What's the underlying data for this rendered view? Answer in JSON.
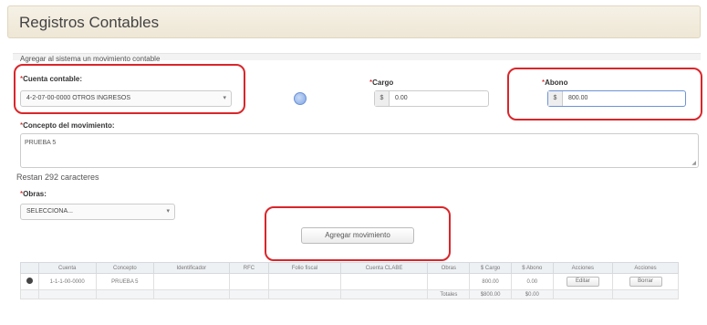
{
  "page": {
    "title": "Registros Contables"
  },
  "hint": "Agregar al sistema un movimiento contable",
  "cuenta": {
    "label": "Cuenta contable:",
    "value": "4-2-07-00-0000 OTROS INGRESOS"
  },
  "cargo": {
    "label": "Cargo",
    "currency": "$",
    "value": "0.00"
  },
  "abono": {
    "label": "Abono",
    "currency": "$",
    "value": "800.00"
  },
  "concepto": {
    "label": "Concepto del movimiento:",
    "value": "PRUEBA 5"
  },
  "remaining": "Restan 292 caracteres",
  "obra": {
    "label": "Obras:",
    "value": "SELECCIONA..."
  },
  "add_button": "Agregar movimiento",
  "table": {
    "headers": [
      "",
      "Cuenta",
      "Concepto",
      "Identificador",
      "RFC",
      "Folio fiscal",
      "Cuenta CLABE",
      "Obras",
      "$ Cargo",
      "$ Abono",
      "Acciones",
      "Acciones"
    ],
    "rows": [
      {
        "cuenta": "1-1-1-00-0000",
        "concepto": "PRUEBA 5",
        "identificador": "",
        "rfc": "",
        "folio": "",
        "clabe": "",
        "obras": "",
        "cargo": "800.00",
        "abono": "0.00",
        "accion1": "Editar",
        "accion2": "Borrar"
      }
    ],
    "totals": {
      "label": "Totales",
      "cargo": "$800.00",
      "abono": "$0.00"
    }
  },
  "colors": {
    "highlight": "#d9262b",
    "accent": "#7fa6e6"
  }
}
